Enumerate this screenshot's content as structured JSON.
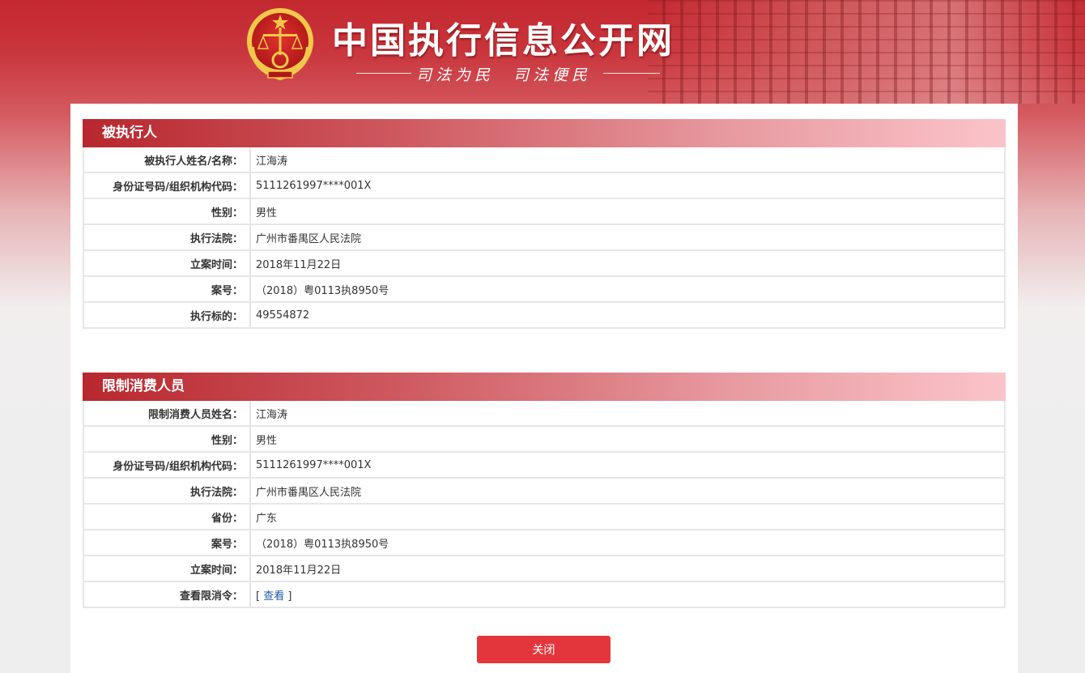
{
  "header": {
    "title": "中国执行信息公开网",
    "slogan": "司法为民　司法便民"
  },
  "colors": {
    "brand_red": "#c3282f",
    "button_red": "#e3363c",
    "link_blue": "#1f5aa8"
  },
  "icons": {
    "emblem": "national-court-emblem-icon"
  },
  "executee": {
    "heading": "被执行人",
    "rows": [
      {
        "label": "被执行人姓名/名称：",
        "value": "江海涛"
      },
      {
        "label": "身份证号码/组织机构代码：",
        "value": "5111261997****001X"
      },
      {
        "label": "性别：",
        "value": "男性"
      },
      {
        "label": "执行法院：",
        "value": "广州市番禺区人民法院"
      },
      {
        "label": "立案时间：",
        "value": "2018年11月22日"
      },
      {
        "label": "案号：",
        "value": "（2018）粤0113执8950号"
      },
      {
        "label": "执行标的：",
        "value": "49554872"
      }
    ]
  },
  "restricted": {
    "heading": "限制消费人员",
    "rows": [
      {
        "label": "限制消费人员姓名：",
        "value": "江海涛"
      },
      {
        "label": "性别：",
        "value": "男性"
      },
      {
        "label": "身份证号码/组织机构代码：",
        "value": "5111261997****001X"
      },
      {
        "label": "执行法院：",
        "value": "广州市番禺区人民法院"
      },
      {
        "label": "省份：",
        "value": "广东"
      },
      {
        "label": "案号：",
        "value": "（2018）粤0113执8950号"
      },
      {
        "label": "立案时间：",
        "value": "2018年11月22日"
      }
    ],
    "order_label": "查看限消令：",
    "order_open": "[ ",
    "order_link": "查看",
    "order_close": " ]"
  },
  "close_button": "关闭"
}
